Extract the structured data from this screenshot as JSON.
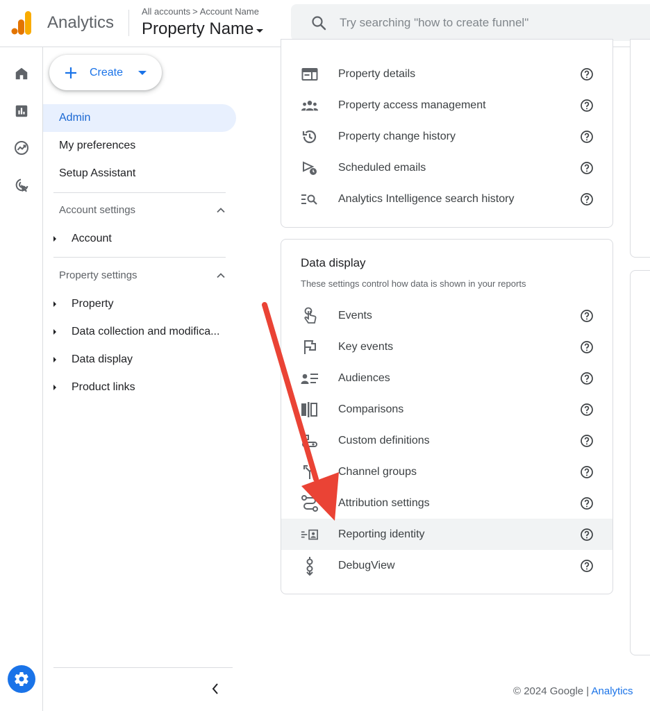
{
  "header": {
    "app_name": "Analytics",
    "breadcrumb_root": "All accounts",
    "breadcrumb_sep": ">",
    "breadcrumb_account": "Account Name",
    "property_name": "Property Name",
    "search_placeholder": "Try searching \"how to create funnel\""
  },
  "rail": {
    "items": [
      "home-icon",
      "reports-icon",
      "explore-icon",
      "advertising-icon"
    ],
    "settings": "gear-icon"
  },
  "nav": {
    "create_label": "Create",
    "items": [
      {
        "label": "Admin",
        "active": true
      },
      {
        "label": "My preferences",
        "active": false
      },
      {
        "label": "Setup Assistant",
        "active": false
      }
    ],
    "account_settings": {
      "label": "Account settings",
      "items": [
        "Account"
      ]
    },
    "property_settings": {
      "label": "Property settings",
      "items": [
        "Property",
        "Data collection and modifica...",
        "Data display",
        "Product links"
      ]
    }
  },
  "property_card": {
    "rows": [
      {
        "label": "Property details",
        "icon": "property-details-icon"
      },
      {
        "label": "Property access management",
        "icon": "people-icon"
      },
      {
        "label": "Property change history",
        "icon": "history-icon"
      },
      {
        "label": "Scheduled emails",
        "icon": "scheduled-email-icon"
      },
      {
        "label": "Analytics Intelligence search history",
        "icon": "search-history-icon"
      }
    ]
  },
  "data_display_card": {
    "title": "Data display",
    "subtitle": "These settings control how data is shown in your reports",
    "rows": [
      {
        "label": "Events",
        "icon": "touch-icon"
      },
      {
        "label": "Key events",
        "icon": "flag-icon"
      },
      {
        "label": "Audiences",
        "icon": "audiences-icon"
      },
      {
        "label": "Comparisons",
        "icon": "comparisons-icon"
      },
      {
        "label": "Custom definitions",
        "icon": "custom-definitions-icon"
      },
      {
        "label": "Channel groups",
        "icon": "merge-icon"
      },
      {
        "label": "Attribution settings",
        "icon": "attribution-icon"
      },
      {
        "label": "Reporting identity",
        "icon": "reporting-identity-icon",
        "highlighted": true
      },
      {
        "label": "DebugView",
        "icon": "debug-icon"
      }
    ]
  },
  "footer": {
    "copyright": "© 2024 Google | ",
    "link": "Analytics"
  },
  "colors": {
    "accent": "#1a73e8",
    "annotation_arrow": "#ea4335",
    "logo_orange": "#f9ab00",
    "logo_dark": "#e37400"
  }
}
